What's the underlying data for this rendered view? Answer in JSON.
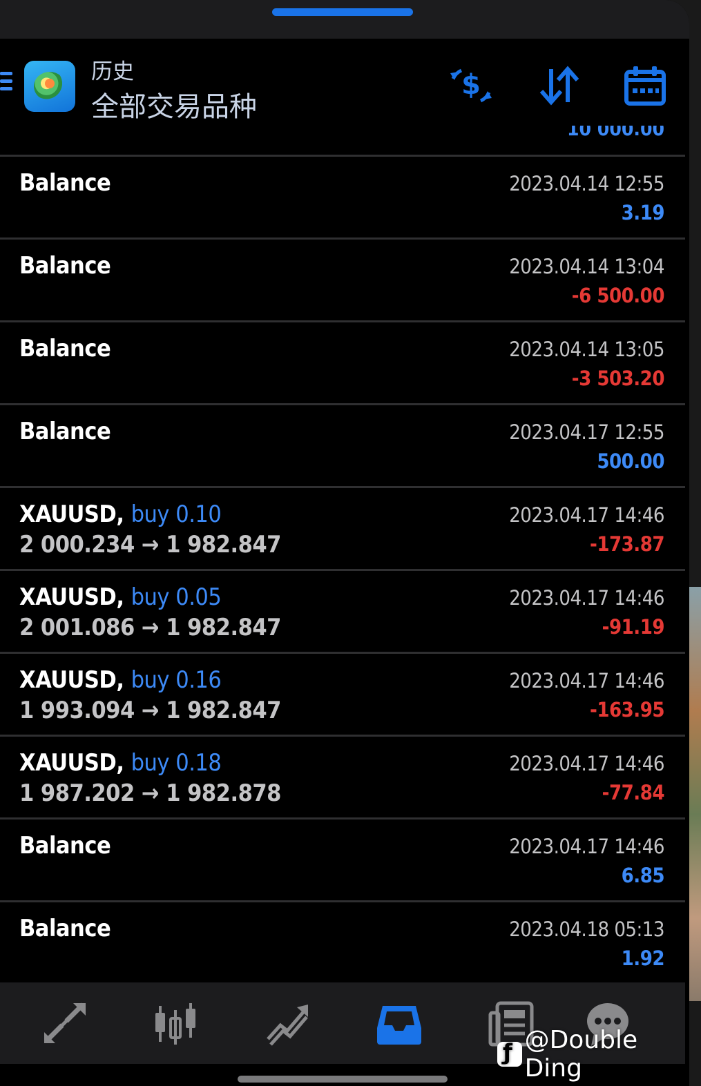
{
  "header": {
    "title_small": "历史",
    "title_big": "全部交易品种",
    "icons": [
      "dollar-exchange-icon",
      "sort-icon",
      "calendar-icon"
    ]
  },
  "peek_value": "10 000.00",
  "rows": [
    {
      "type": "balance",
      "name": "Balance",
      "date": "2023.04.14 12:55",
      "amount": "3.19",
      "sign": "pos"
    },
    {
      "type": "balance",
      "name": "Balance",
      "date": "2023.04.14 13:04",
      "amount": "-6 500.00",
      "sign": "neg"
    },
    {
      "type": "balance",
      "name": "Balance",
      "date": "2023.04.14 13:05",
      "amount": "-3 503.20",
      "sign": "neg"
    },
    {
      "type": "balance",
      "name": "Balance",
      "date": "2023.04.17 12:55",
      "amount": "500.00",
      "sign": "pos"
    },
    {
      "type": "trade",
      "symbol": "XAUUSD,",
      "deal": "buy 0.10",
      "open": "2 000.234",
      "close": "1 982.847",
      "date": "2023.04.17 14:46",
      "amount": "-173.87",
      "sign": "neg"
    },
    {
      "type": "trade",
      "symbol": "XAUUSD,",
      "deal": "buy 0.05",
      "open": "2 001.086",
      "close": "1 982.847",
      "date": "2023.04.17 14:46",
      "amount": "-91.19",
      "sign": "neg"
    },
    {
      "type": "trade",
      "symbol": "XAUUSD,",
      "deal": "buy 0.16",
      "open": "1 993.094",
      "close": "1 982.847",
      "date": "2023.04.17 14:46",
      "amount": "-163.95",
      "sign": "neg"
    },
    {
      "type": "trade",
      "symbol": "XAUUSD,",
      "deal": "buy 0.18",
      "open": "1 987.202",
      "close": "1 982.878",
      "date": "2023.04.17 14:46",
      "amount": "-77.84",
      "sign": "neg"
    },
    {
      "type": "balance",
      "name": "Balance",
      "date": "2023.04.17 14:46",
      "amount": "6.85",
      "sign": "pos"
    },
    {
      "type": "balance",
      "name": "Balance",
      "date": "2023.04.18 05:13",
      "amount": "1.92",
      "sign": "pos"
    }
  ],
  "bottom_nav": [
    {
      "name": "quotes-icon",
      "active": false
    },
    {
      "name": "chart-icon",
      "active": false
    },
    {
      "name": "trade-icon",
      "active": false
    },
    {
      "name": "history-icon",
      "active": true
    },
    {
      "name": "news-icon",
      "active": false
    },
    {
      "name": "chat-icon",
      "active": false
    }
  ],
  "watermark": "@Double Ding",
  "colors": {
    "accent": "#3d8af7",
    "negative": "#e53935",
    "background": "#000000",
    "divider": "#2f2f31",
    "nav_inactive": "#8a8a8c"
  }
}
